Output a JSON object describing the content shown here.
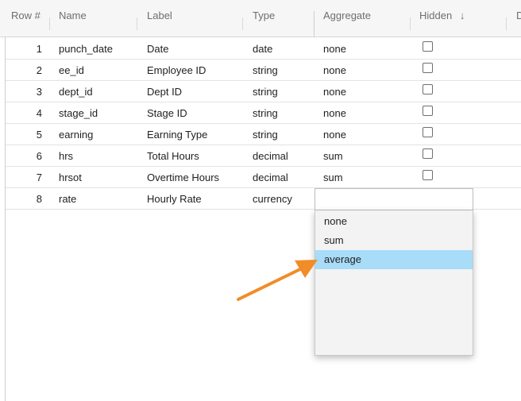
{
  "columns": {
    "row_num": "Row #",
    "name": "Name",
    "label": "Label",
    "type": "Type",
    "aggregate": "Aggregate",
    "hidden": "Hidden",
    "sort_indicator": "↓",
    "next_partial": "D"
  },
  "rows": [
    {
      "num": "1",
      "name": "punch_date",
      "label": "Date",
      "type": "date",
      "aggregate": "none",
      "hidden": false
    },
    {
      "num": "2",
      "name": "ee_id",
      "label": "Employee ID",
      "type": "string",
      "aggregate": "none",
      "hidden": false
    },
    {
      "num": "3",
      "name": "dept_id",
      "label": "Dept ID",
      "type": "string",
      "aggregate": "none",
      "hidden": false
    },
    {
      "num": "4",
      "name": "stage_id",
      "label": "Stage ID",
      "type": "string",
      "aggregate": "none",
      "hidden": false
    },
    {
      "num": "5",
      "name": "earning",
      "label": "Earning Type",
      "type": "string",
      "aggregate": "none",
      "hidden": false
    },
    {
      "num": "6",
      "name": "hrs",
      "label": "Total Hours",
      "type": "decimal",
      "aggregate": "sum",
      "hidden": false
    },
    {
      "num": "7",
      "name": "hrsot",
      "label": "Overtime Hours",
      "type": "decimal",
      "aggregate": "sum",
      "hidden": false
    },
    {
      "num": "8",
      "name": "rate",
      "label": "Hourly Rate",
      "type": "currency",
      "aggregate": "",
      "hidden": null
    }
  ],
  "aggregate_dropdown": {
    "value": "",
    "options": [
      "none",
      "sum",
      "average"
    ],
    "highlighted": "average"
  },
  "annotation": {
    "icon": "arrow-icon",
    "color": "#f28c28"
  },
  "colors": {
    "highlight": "#a8dcf8",
    "dropdown_bg": "#f2f3f2",
    "header_bg": "#f6f6f6"
  }
}
